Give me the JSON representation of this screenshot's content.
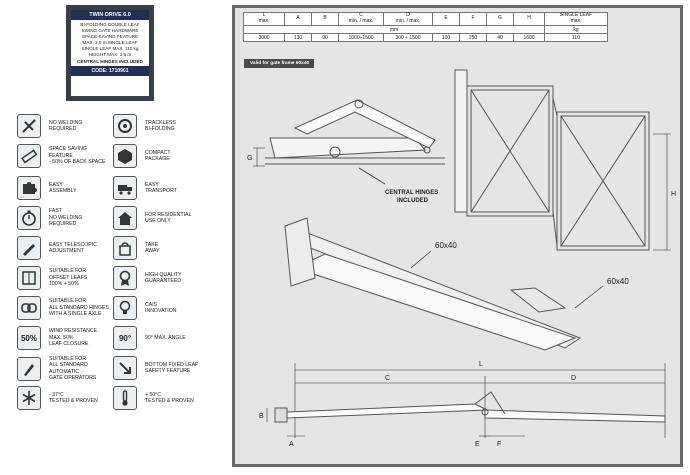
{
  "product_label": {
    "title": "TWIN DRIVE 6.0",
    "lines": [
      "BI-FOLDING DOUBLE LEAF",
      "SWING GATE HARDWARE",
      "SPACE-SAVING FEATURE",
      "MAX. 3,0 m SINGLE LEAF",
      "SINGLE LEAF MAX. 110 kg",
      "HEIGHT MAX. 1,6 m"
    ],
    "bold_line": "CENTRAL HINGES INCLUDED",
    "code": "CODE: 1710901"
  },
  "features": [
    {
      "icon": "no-welding-icon",
      "lines": [
        "NO WELDING",
        "REQUIRED"
      ]
    },
    {
      "icon": "trackless-wheel-icon",
      "lines": [
        "TRACKLESS",
        "BI-FOLDING"
      ]
    },
    {
      "icon": "ruler-icon",
      "lines": [
        "SPACE SAVING",
        "FEATURE",
        "- 50% OF BACK SPACE"
      ]
    },
    {
      "icon": "package-box-icon",
      "lines": [
        "COMPACT",
        "PACKAGE"
      ]
    },
    {
      "icon": "puzzle-icon",
      "lines": [
        "EASY",
        "ASSEMBLY"
      ]
    },
    {
      "icon": "truck-icon",
      "lines": [
        "EASY",
        "TRANSPORT"
      ]
    },
    {
      "icon": "stopwatch-icon",
      "lines": [
        "FAST",
        "NO WELDING",
        "REQUIRED"
      ]
    },
    {
      "icon": "house-icon",
      "lines": [
        "FOR RESIDENTIAL",
        "USE ONLY"
      ]
    },
    {
      "icon": "pen-adjust-icon",
      "lines": [
        "EASY TELESCOPIC",
        "ADJUSTMENT"
      ]
    },
    {
      "icon": "shopping-bag-icon",
      "lines": [
        "TAKE",
        "AWAY"
      ]
    },
    {
      "icon": "offset-frame-icon",
      "lines": [
        "SUITABLE FOR",
        "OFFSET LEAFS",
        "100% + 50%"
      ]
    },
    {
      "icon": "quality-ribbon-icon",
      "lines": [
        "HIGH QUALITY",
        "GUARANTEED"
      ]
    },
    {
      "icon": "hinge-link-icon",
      "lines": [
        "SUITABLE FOR",
        "ALL STANDARD HINGES",
        "WITH A SINGLE AXLE"
      ]
    },
    {
      "icon": "lightbulb-icon",
      "lines": [
        "CAIS",
        "INNOVATION"
      ]
    },
    {
      "icon": "percent-50-icon",
      "text": "50%",
      "lines": [
        "WIND RESISTANCE",
        "MAX. 50%",
        "LEAF CLOSURE"
      ]
    },
    {
      "icon": "angle-90-icon",
      "text": "90°",
      "lines": [
        "90° MAX. ANGLE"
      ]
    },
    {
      "icon": "gate-operator-icon",
      "lines": [
        "SUITABLE FOR",
        "ALL STANDARD",
        "AUTOMATIC",
        "GATE OPERATORS"
      ]
    },
    {
      "icon": "fixed-leaf-arrow-icon",
      "lines": [
        "BOTTOM FIXED LEAF",
        "SAFETY FEATURE"
      ]
    },
    {
      "icon": "snowflake-icon",
      "lines": [
        "- 37°C",
        "TESTED & PROVEN"
      ]
    },
    {
      "icon": "thermometer-icon",
      "lines": [
        "+ 50°C",
        "TESTED & PROVEN"
      ]
    }
  ],
  "dimension_table": {
    "headers": [
      "L\nmax.",
      "A",
      "B",
      "C\nmin. / max.",
      "D\nmin. / max.",
      "E",
      "F",
      "G",
      "H",
      "SINGLE LEAF\nmax."
    ],
    "units": [
      "",
      "",
      "",
      "mm",
      "",
      "",
      "",
      "",
      "",
      "kg"
    ],
    "values": [
      "3000",
      "130",
      "90",
      "1000÷1500",
      "300 ÷ 1500",
      "100",
      "250",
      "40",
      "1600",
      "110"
    ]
  },
  "valid_banner": "Valid for gate frame 60x40",
  "drawing_labels": {
    "central_hinges": [
      "CENTRAL HINGES",
      "INCLUDED"
    ],
    "profile_1": "60x40",
    "profile_2": "60x40",
    "dim_g": "G",
    "dim_h": "H",
    "dim_l": "L",
    "dim_c": "C",
    "dim_d": "D",
    "dim_a": "A",
    "dim_b": "B",
    "dim_e": "E",
    "dim_f": "F"
  }
}
